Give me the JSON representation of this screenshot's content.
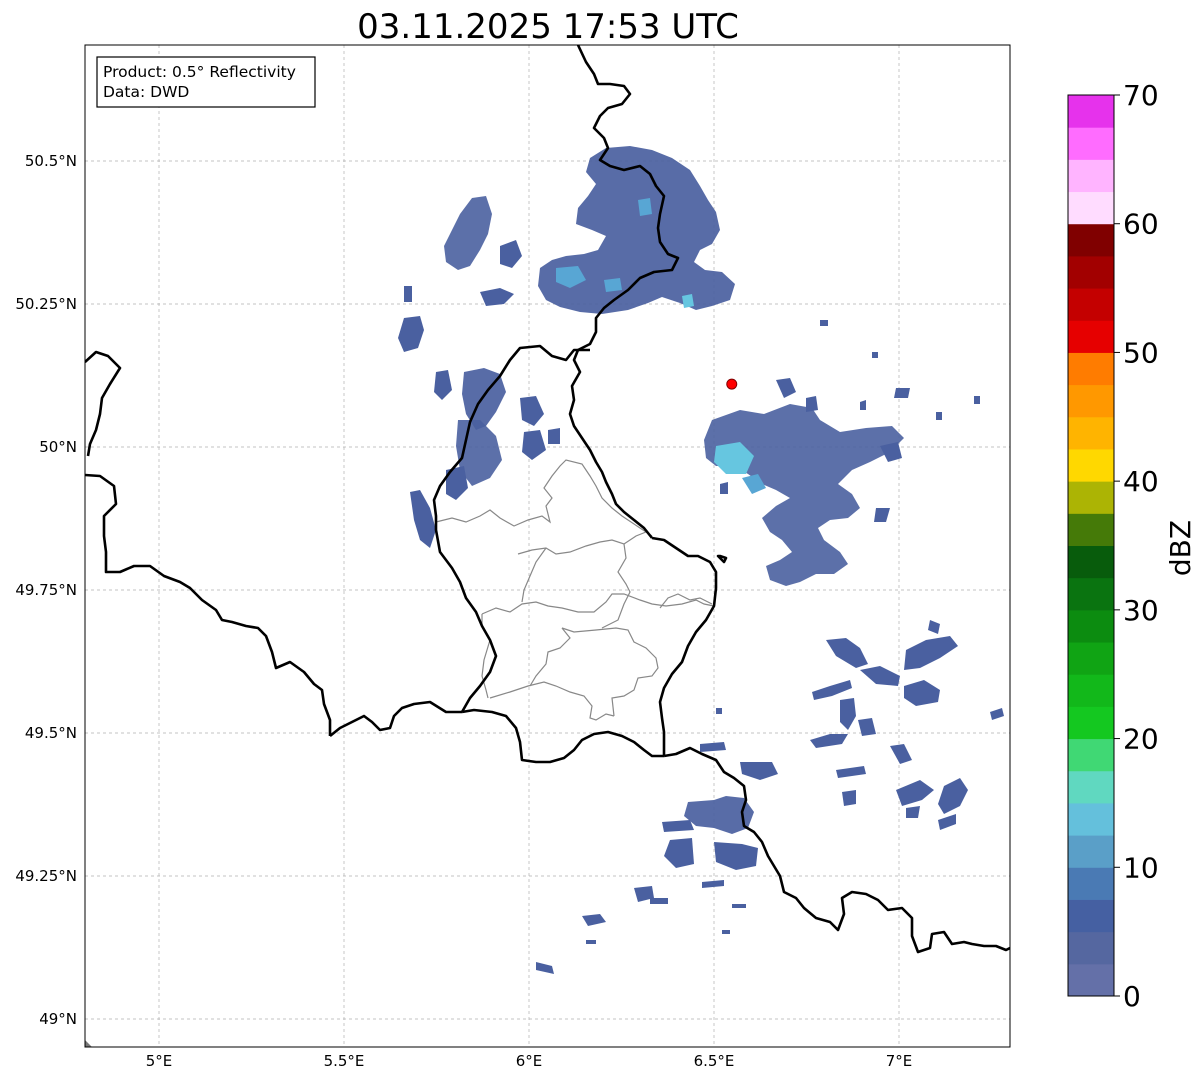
{
  "title": "03.11.2025 17:53 UTC",
  "info_box": {
    "product": "Product: 0.5° Reflectivity",
    "data": "Data: DWD"
  },
  "map": {
    "lon_range": [
      4.8,
      7.3
    ],
    "lat_range": [
      48.95,
      50.7
    ],
    "lon_ticks": [
      {
        "value": 5.0,
        "label": "5°E"
      },
      {
        "value": 5.5,
        "label": "5.5°E"
      },
      {
        "value": 6.0,
        "label": "6°E"
      },
      {
        "value": 6.5,
        "label": "6.5°E"
      },
      {
        "value": 7.0,
        "label": "7°E"
      }
    ],
    "lat_ticks": [
      {
        "value": 49.0,
        "label": "49°N"
      },
      {
        "value": 49.25,
        "label": "49.25°N"
      },
      {
        "value": 49.5,
        "label": "49.5°N"
      },
      {
        "value": 49.75,
        "label": "49.75°N"
      },
      {
        "value": 50.0,
        "label": "50°N"
      },
      {
        "value": 50.25,
        "label": "50.25°N"
      },
      {
        "value": 50.5,
        "label": "50.5°N"
      }
    ],
    "grid": true,
    "radar_site": {
      "lon": 6.548,
      "lat": 50.11,
      "color": "#ff0000"
    }
  },
  "colorbar": {
    "label": "dBZ",
    "min": 0,
    "max": 70,
    "tick_labels": [
      "0",
      "10",
      "20",
      "30",
      "40",
      "50",
      "60",
      "70"
    ],
    "colors": [
      "#6470a8",
      "#5567a0",
      "#4560a2",
      "#4a7ab4",
      "#5a9fc8",
      "#64c0dc",
      "#60d8c0",
      "#40d874",
      "#14c820",
      "#12b81a",
      "#10a414",
      "#0c8c10",
      "#0a7410",
      "#085c0c",
      "#457a08",
      "#acb404",
      "#ffd800",
      "#ffb400",
      "#ff9800",
      "#ff7c00",
      "#e60000",
      "#c40000",
      "#a20000",
      "#800000",
      "#ffdcff",
      "#ffb4ff",
      "#ff6cff",
      "#e632ec"
    ]
  },
  "colors": {
    "echo_main": "#4a60a0",
    "echo_light": "#58a6d4",
    "echo_bright": "#66c6e0",
    "border_national": "#000000",
    "border_cantonal": "#888888",
    "grid": "#b0b0b0"
  }
}
